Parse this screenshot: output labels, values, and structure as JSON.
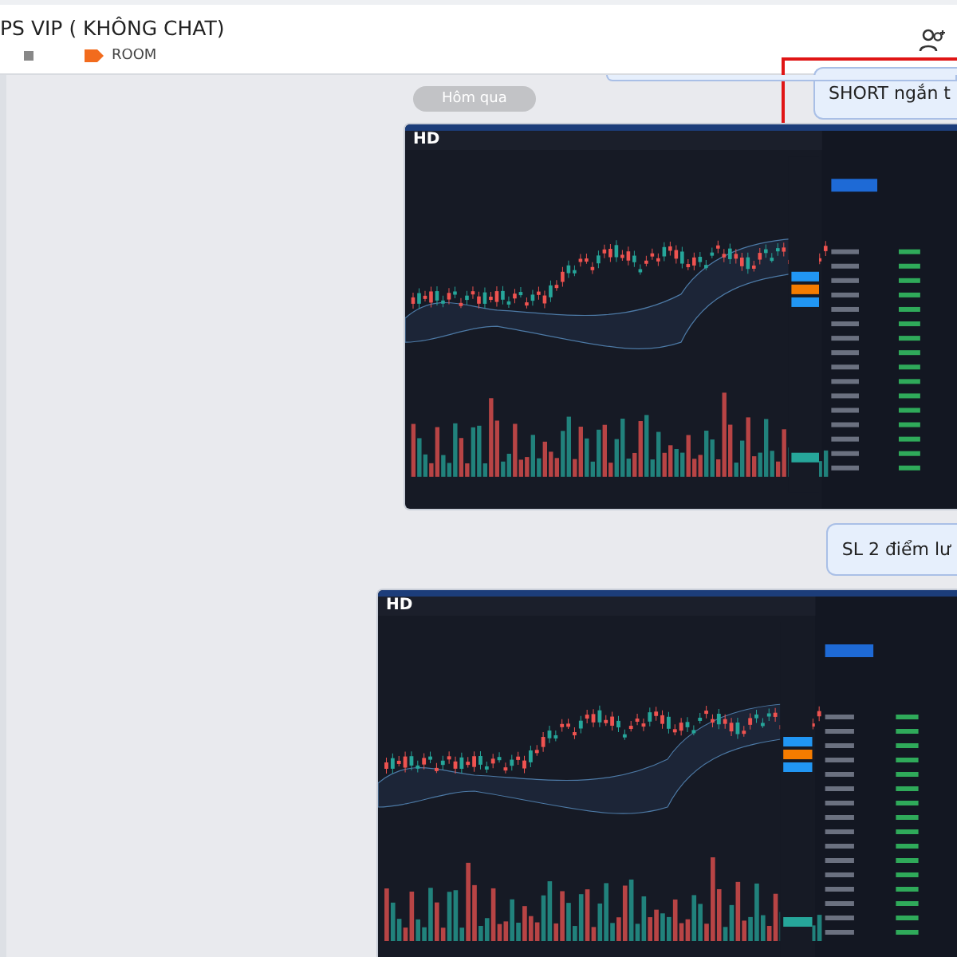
{
  "header": {
    "title": "PS VIP ( KHÔNG CHAT)",
    "tag": "ROOM"
  },
  "date_separator": "Hôm qua",
  "messages": [
    {
      "kind": "text",
      "text": "SHORT ngắn t",
      "highlighted": true
    },
    {
      "kind": "image",
      "badge": "HD"
    },
    {
      "kind": "text",
      "text": "SL 2 điểm lư",
      "highlighted": false
    },
    {
      "kind": "image",
      "badge": "HD"
    }
  ]
}
